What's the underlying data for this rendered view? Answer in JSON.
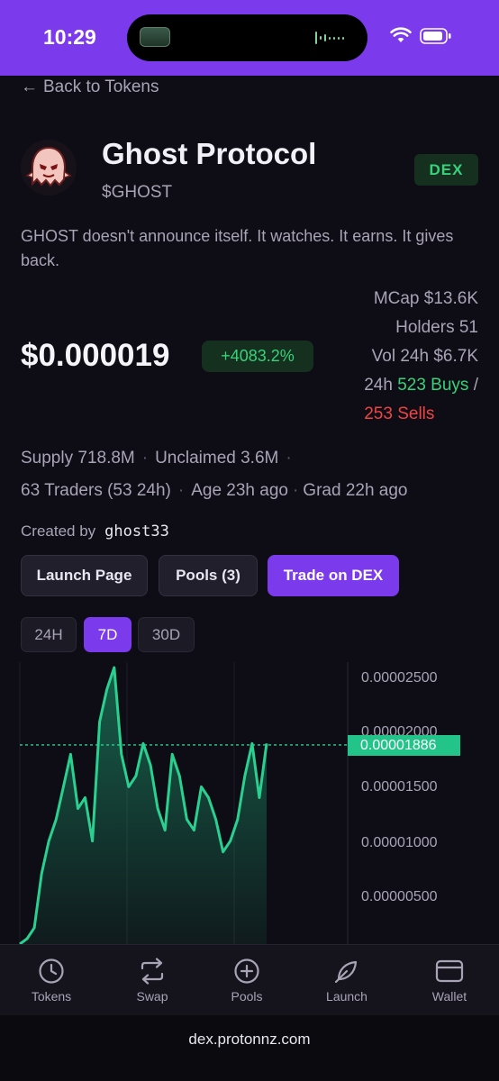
{
  "status_bar": {
    "time": "10:29"
  },
  "nav": {
    "back_label": "Back to Tokens"
  },
  "token": {
    "name": "Ghost Protocol",
    "symbol": "$GHOST",
    "badge": "DEX",
    "description": "GHOST doesn't announce itself. It watches. It earns. It gives back.",
    "price": "$0.000019",
    "change": "+4083.2%"
  },
  "stats": {
    "mcap": "MCap $13.6K",
    "holders": "Holders 51",
    "vol24h": "Vol 24h $6.7K",
    "buys_prefix": "24h ",
    "buys": "523 Buys",
    "buys_sep": " /",
    "sells": "253 Sells"
  },
  "meta": {
    "supply": "Supply 718.8M",
    "unclaimed": "Unclaimed 3.6M",
    "traders": "63 Traders (53 24h)",
    "age": "Age 23h ago",
    "grad": "Grad 22h ago",
    "sep": "·"
  },
  "creator": {
    "label": "Created by",
    "name": "ghost33"
  },
  "actions": {
    "launch_page": "Launch Page",
    "pools": "Pools (3)",
    "trade": "Trade on DEX"
  },
  "ranges": {
    "h24": "24H",
    "d7": "7D",
    "d30": "30D",
    "selected": "7D"
  },
  "chart_data": {
    "type": "area",
    "y_ticks": [
      "0.00002500",
      "0.00002000",
      "0.00001500",
      "0.00001000",
      "0.00000500"
    ],
    "current_price_label": "0.00001886",
    "current_price": 1.886e-05,
    "ylim": [
      5e-07,
      2.65e-05
    ],
    "values": [
      5e-07,
      1e-06,
      2e-06,
      7e-06,
      1e-05,
      1.2e-05,
      1.5e-05,
      1.8e-05,
      1.3e-05,
      1.4e-05,
      1e-05,
      2.1e-05,
      2.4e-05,
      2.6e-05,
      1.8e-05,
      1.5e-05,
      1.6e-05,
      1.9e-05,
      1.7e-05,
      1.3e-05,
      1.1e-05,
      1.8e-05,
      1.6e-05,
      1.2e-05,
      1.1e-05,
      1.5e-05,
      1.4e-05,
      1.2e-05,
      9e-06,
      1e-05,
      1.2e-05,
      1.6e-05,
      1.9e-05,
      1.4e-05,
      1.9e-05
    ],
    "color": "#22c48a"
  },
  "tabs": [
    {
      "label": "Tokens",
      "icon": "clock-icon"
    },
    {
      "label": "Swap",
      "icon": "swap-icon"
    },
    {
      "label": "Pools",
      "icon": "plus-circle-icon"
    },
    {
      "label": "Launch",
      "icon": "rocket-icon"
    },
    {
      "label": "Wallet",
      "icon": "wallet-icon"
    }
  ],
  "browser": {
    "url": "dex.protonnz.com"
  },
  "colors": {
    "accent": "#7c3aed",
    "positive": "#37d27a",
    "negative": "#ef4444"
  }
}
